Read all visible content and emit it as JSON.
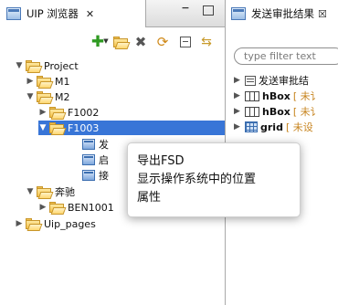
{
  "left_view": {
    "tab_label": "UIP 浏览器",
    "close_glyph": "✕",
    "minimize_glyph": "−",
    "toolbar_icons": [
      "add-icon",
      "new-folder-icon",
      "delete-icon",
      "refresh-icon",
      "collapse-all-icon",
      "link-editor-icon"
    ],
    "tree": [
      {
        "label": "Project",
        "expanded": true
      },
      {
        "label": "M1",
        "expanded": false
      },
      {
        "label": "M2",
        "expanded": true
      },
      {
        "label": "F1002",
        "expanded": false
      },
      {
        "label": "F1003",
        "expanded": true,
        "selected": true
      },
      {
        "label": "发",
        "type": "file"
      },
      {
        "label": "启",
        "type": "file"
      },
      {
        "label": "接",
        "type": "file"
      },
      {
        "label": "奔驰",
        "expanded": true
      },
      {
        "label": "BEN1001",
        "expanded": false
      },
      {
        "label": "Uip_pages",
        "expanded": false
      }
    ]
  },
  "right_view": {
    "tab_label": "发送审批结果",
    "tab_suffix": "☒",
    "filter_placeholder": "type filter text",
    "items": [
      {
        "name": "发送审批结",
        "tag": ""
      },
      {
        "name": "hBox",
        "tag": "[ 未讠"
      },
      {
        "name": "hBox",
        "tag": "[ 未讠"
      },
      {
        "name": "grid",
        "tag": "[ 未设"
      }
    ]
  },
  "context_menu": {
    "items": [
      "导出FSD",
      "显示操作系统中的位置",
      "属性"
    ]
  },
  "colors": {
    "selection": "#3875d7",
    "tag": "#c7841f"
  }
}
